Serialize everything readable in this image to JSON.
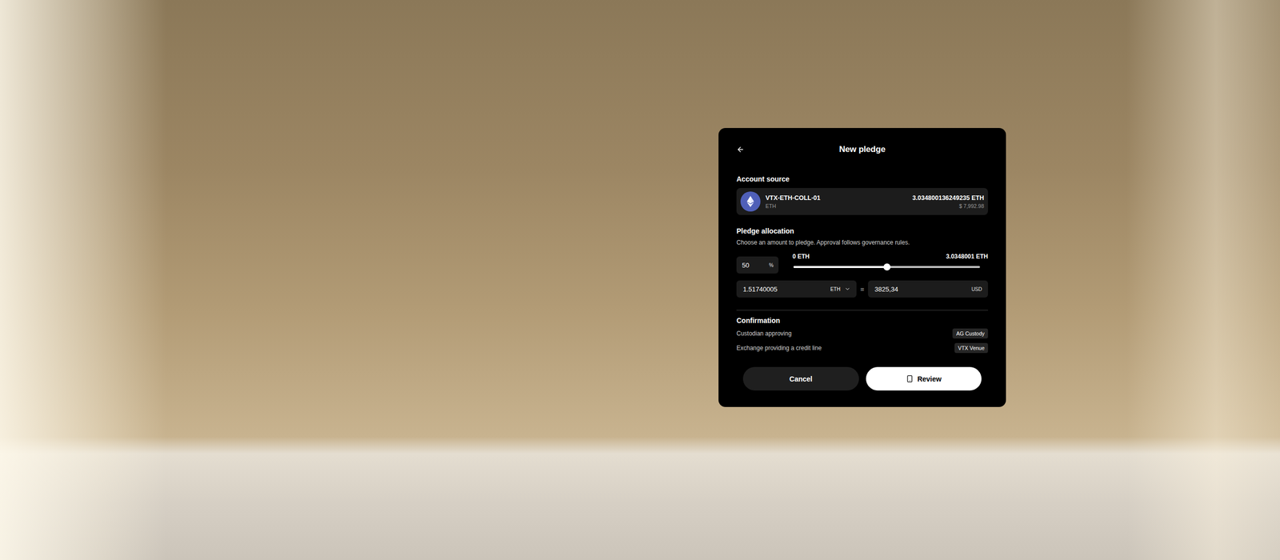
{
  "dialog": {
    "title": "New pledge"
  },
  "account_source": {
    "title": "Account source",
    "name": "VTX-ETH-COLL-01",
    "asset": "ETH",
    "balance": "3.034800136249235 ETH",
    "fiat": "$ 7,992.98"
  },
  "allocation": {
    "title": "Pledge allocation",
    "description": "Choose an amount to pledge. Approval follows governance rules.",
    "percent": "50",
    "percent_unit": "%",
    "min_label": "0 ETH",
    "max_label": "3.0348001 ETH",
    "level": 0.5,
    "amount": "1.51740005",
    "amount_unit": "ETH",
    "equals": "=",
    "fiat_amount": "3825,34",
    "fiat_unit": "USD"
  },
  "confirmation": {
    "title": "Confirmation",
    "rows": [
      {
        "label": "Custodian approving",
        "value": "AG Custody"
      },
      {
        "label": "Exchange providing a credit line",
        "value": "VTX Venue"
      }
    ]
  },
  "buttons": [
    {
      "label": "Cancel",
      "kind": "secondary"
    },
    {
      "label": "Review",
      "kind": "primary"
    }
  ]
}
